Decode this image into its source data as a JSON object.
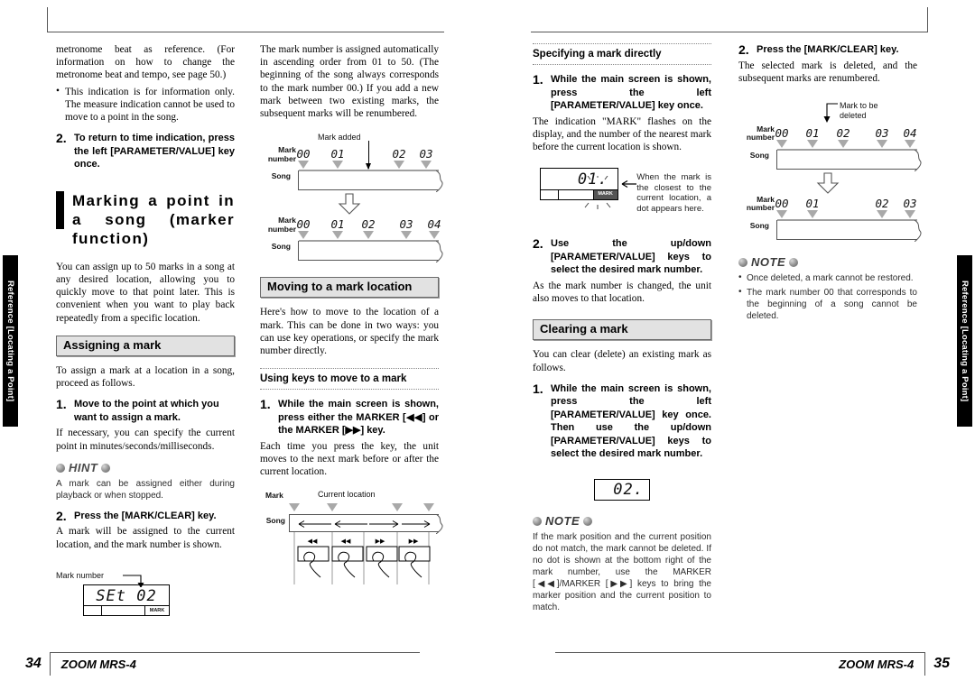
{
  "side_tabs": {
    "left": "Reference [Locating a Point]",
    "right": "Reference [Locating a Point]"
  },
  "footer": {
    "left_page_number": "34",
    "left_book": "ZOOM MRS-4",
    "right_book": "ZOOM MRS-4",
    "right_page_number": "35"
  },
  "column1": {
    "continued_para": "metronome beat as reference. (For information on how to change the metronome beat and tempo, see page 50.)",
    "bullets": [
      "This indication is for information only. The measure indication cannot be used to move to a point in the song."
    ],
    "step2": {
      "num": "2.",
      "text": "To return to time indication, press the left [PARAMETER/VALUE] key once."
    },
    "chapter_title": "Marking a point in a song (marker function)",
    "chapter_intro": "You can assign up to 50 marks in a song at any desired location, allowing you to quickly move to that point later. This is convenient when you want to play back repeatedly from a specific location.",
    "section_assigning": "Assigning a mark",
    "assigning_intro": "To assign a mark at a location in a song, proceed as follows.",
    "step1": {
      "num": "1.",
      "text": "Move to the point at which you want to assign a mark."
    },
    "step1_body": "If necessary, you can specify the current point in minutes/seconds/milliseconds.",
    "hint_label": "HINT",
    "hint_body": "A mark can be assigned either during playback or when stopped.",
    "step2b": {
      "num": "2.",
      "text": "Press the [MARK/CLEAR] key."
    },
    "step2b_body": "A mark will be assigned to the current location, and the mark number is shown.",
    "lcd": {
      "caption": "Mark number",
      "digits": "SEt 02",
      "seg_label": "MARK"
    }
  },
  "column2": {
    "para1": "The mark number is assigned automatically in ascending order from 01 to 50. (The beginning of the song always corresponds to the mark number 00.) If you add a new mark between two existing marks, the subsequent marks will be renumbered.",
    "diagram": {
      "caption": "Mark added",
      "mark_label_line1": "Mark",
      "mark_label_line2": "number",
      "song_label": "Song",
      "before_marks": [
        "00",
        "01",
        "02",
        "03"
      ],
      "after_marks": [
        "00",
        "01",
        "02",
        "03",
        "04"
      ]
    },
    "section_moving": "Moving to a mark location",
    "moving_intro": "Here's how to move to the location of a mark. This can be done in two ways: you can use key operations, or specify the mark number directly.",
    "sub_using_keys": "Using keys to move to a mark",
    "step1": {
      "num": "1.",
      "text": "While the main screen is shown, press either the MARKER [◀◀] or the MARKER [▶▶] key."
    },
    "step1_body": "Each time you press the key, the unit moves to the next mark before or after the current location.",
    "keys_diagram": {
      "mark_label": "Mark",
      "current_label": "Current location",
      "song_label": "Song",
      "keys": [
        "◀◀",
        "◀◀",
        "▶▶",
        "▶▶"
      ]
    }
  },
  "column3": {
    "sub_specifying": "Specifying a mark directly",
    "step1": {
      "num": "1.",
      "text": "While the main screen is shown, press the left [PARAMETER/VALUE] key once."
    },
    "step1_body": "The indication \"MARK\" flashes on the display, and the number of the nearest mark before the current location is shown.",
    "lcd": {
      "digits": "01.",
      "seg_label": "MARK",
      "callout": "When the mark is the closest to the current location, a dot appears here."
    },
    "step2": {
      "num": "2.",
      "text": "Use the up/down [PARAMETER/VALUE] keys to select the desired mark number."
    },
    "step2_body": "As the mark number is changed, the unit also moves to that location.",
    "section_clearing": "Clearing a mark",
    "clearing_intro": "You can clear (delete) an existing mark as follows.",
    "step1b": {
      "num": "1.",
      "text": "While the main screen is shown, press the left [PARAMETER/VALUE] key once. Then use the up/down [PARAMETER/VALUE] keys to select the desired mark number."
    },
    "lcd2": {
      "digits": "02."
    },
    "note_label": "NOTE",
    "note_body": "If the mark position and the current position do not match, the mark cannot be deleted. If no dot is shown at the bottom right of the mark number, use the MARKER [◀◀]/MARKER [▶▶] keys to bring the marker position and the current position to match."
  },
  "column4": {
    "step2": {
      "num": "2.",
      "text": "Press the [MARK/CLEAR] key."
    },
    "step2_body": "The selected mark is deleted, and the subsequent marks are renumbered.",
    "diagram": {
      "caption_line1": "Mark to be",
      "caption_line2": "deleted",
      "mark_label_line1": "Mark",
      "mark_label_line2": "number",
      "song_label": "Song",
      "before_marks": [
        "00",
        "01",
        "02",
        "03",
        "04"
      ],
      "after_marks": [
        "00",
        "01",
        "02",
        "03"
      ]
    },
    "note_label": "NOTE",
    "notes": [
      "Once deleted, a mark cannot be restored.",
      "The mark number 00 that corresponds to the beginning of a song cannot be deleted."
    ]
  }
}
